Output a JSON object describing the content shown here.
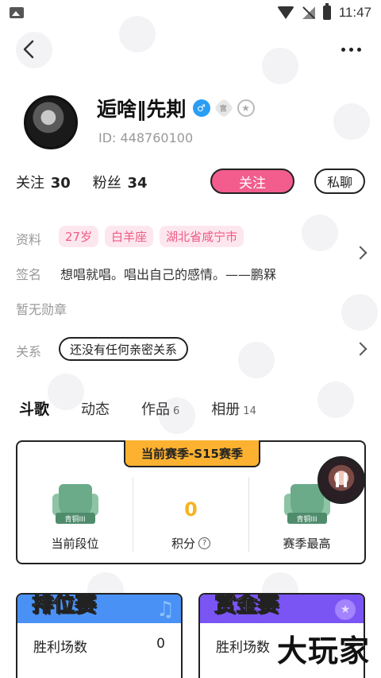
{
  "status_bar": {
    "time": "11:47"
  },
  "profile": {
    "name": "逅啥‖先剘",
    "id_text": "ID: 448760100",
    "level_badge": "宫",
    "following_label": "关注",
    "following_count": "30",
    "fans_label": "粉丝",
    "fans_count": "34",
    "follow_button": "关注",
    "chat_button": "私聊"
  },
  "info": {
    "profile_label": "资料",
    "tags": [
      "27岁",
      "白羊座",
      "湖北省咸宁市"
    ],
    "signature_label": "签名",
    "signature": "想唱就唱。唱出自己的感情。——鹏槑",
    "medal_text": "暂无勋章",
    "relation_label": "关系",
    "relation_value": "还没有任何亲密关系"
  },
  "tabs": [
    {
      "label": "斗歌",
      "count": ""
    },
    {
      "label": "动态",
      "count": ""
    },
    {
      "label": "作品",
      "count": "6"
    },
    {
      "label": "相册",
      "count": "14"
    }
  ],
  "season": {
    "banner": "当前赛季-S15赛季",
    "rank_badge": "青铜III",
    "current_rank_label": "当前段位",
    "score_value": "0",
    "score_label": "积分",
    "best_rank_badge": "青铜III",
    "best_label": "赛季最高"
  },
  "ranked": {
    "title": "排位赛",
    "wins_label": "胜利场数",
    "wins_value": "0"
  },
  "bounty": {
    "title": "赏金赛",
    "wins_label": "胜利场数"
  },
  "watermark": "大玩家",
  "colors": {
    "accent_pink": "#f25d8e",
    "season_orange": "#fcb130",
    "ranked_blue": "#4a91f5",
    "bounty_purple": "#7b55f4"
  }
}
